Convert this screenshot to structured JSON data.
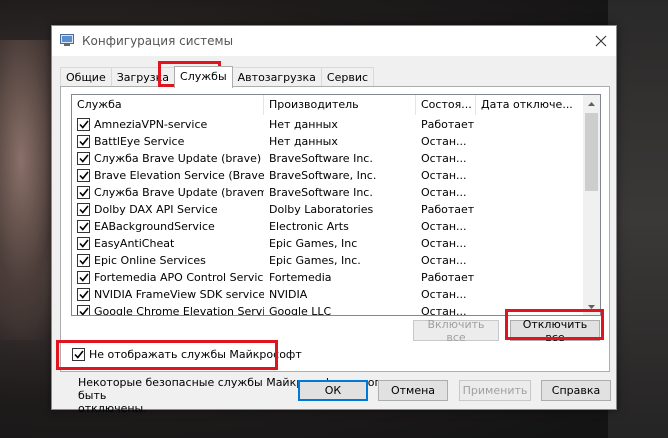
{
  "window": {
    "title": "Конфигурация системы"
  },
  "tabs": [
    {
      "label": "Общие",
      "active": false
    },
    {
      "label": "Загрузка",
      "active": false
    },
    {
      "label": "Службы",
      "active": true
    },
    {
      "label": "Автозагрузка",
      "active": false
    },
    {
      "label": "Сервис",
      "active": false
    }
  ],
  "table": {
    "columns": [
      "Служба",
      "Производитель",
      "Состоя...",
      "Дата отключе..."
    ],
    "rows": [
      {
        "service": "AmneziaVPN-service",
        "vendor": "Нет данных",
        "status": "Работает",
        "date": "",
        "checked": true
      },
      {
        "service": "BattlEye Service",
        "vendor": "Нет данных",
        "status": "Остан...",
        "date": "",
        "checked": true
      },
      {
        "service": "Служба Brave Update (brave)",
        "vendor": "BraveSoftware Inc.",
        "status": "Остан...",
        "date": "",
        "checked": true
      },
      {
        "service": "Brave Elevation Service (BraveEl...",
        "vendor": "BraveSoftware, Inc.",
        "status": "Остан...",
        "date": "",
        "checked": true
      },
      {
        "service": "Служба Brave Update (bravem)",
        "vendor": "BraveSoftware Inc.",
        "status": "Остан...",
        "date": "",
        "checked": true
      },
      {
        "service": "Dolby DAX API Service",
        "vendor": "Dolby Laboratories",
        "status": "Работает",
        "date": "",
        "checked": true
      },
      {
        "service": "EABackgroundService",
        "vendor": "Electronic Arts",
        "status": "Остан...",
        "date": "",
        "checked": true
      },
      {
        "service": "EasyAntiCheat",
        "vendor": "Epic Games, Inc",
        "status": "Остан...",
        "date": "",
        "checked": true
      },
      {
        "service": "Epic Online Services",
        "vendor": "Epic Games, Inc.",
        "status": "Остан...",
        "date": "",
        "checked": true
      },
      {
        "service": "Fortemedia APO Control Service",
        "vendor": "Fortemedia",
        "status": "Работает",
        "date": "",
        "checked": true
      },
      {
        "service": "NVIDIA FrameView SDK service",
        "vendor": "NVIDIA",
        "status": "Остан...",
        "date": "",
        "checked": true
      },
      {
        "service": "Google Chrome Elevation Servic...",
        "vendor": "Google LLC",
        "status": "Остан...",
        "date": "",
        "checked": true
      }
    ]
  },
  "note": {
    "line1": "Некоторые безопасные службы Майкрософт не могут быть",
    "line2": "отключены."
  },
  "buttons": {
    "enable_all": "Включить все",
    "disable_all": "Отключить все",
    "ok": "ОК",
    "cancel": "Отмена",
    "apply": "Применить",
    "help": "Справка"
  },
  "hide_ms": {
    "label": "Не отображать службы Майкрософт",
    "checked": true
  },
  "colors": {
    "highlight": "#e0141e",
    "accent": "#0078d7"
  }
}
